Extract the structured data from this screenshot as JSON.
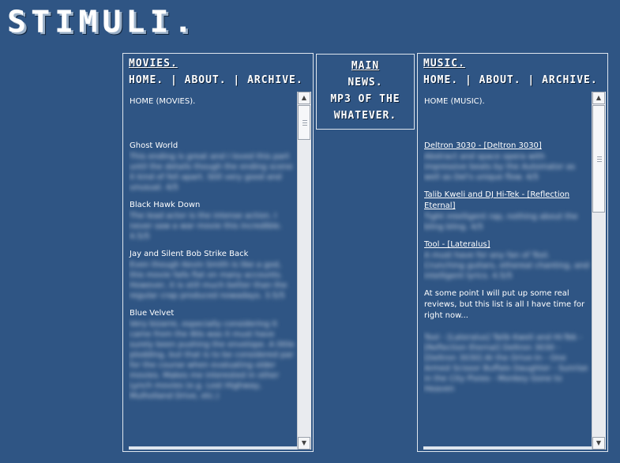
{
  "logo": "STIMULI.",
  "left_panel": {
    "title": "MOVIES.",
    "nav": [
      "HOME.",
      "|",
      "ABOUT.",
      "|",
      "ARCHIVE."
    ],
    "heading": "HOME (MOVIES).",
    "items": [
      {
        "title": "Ghost World",
        "text": "This ending is great and I loved this part until the details though the ending scene it kind of fell apart. Still very good and unusual. 4/5"
      },
      {
        "title": "Black Hawk Down",
        "text": "The lead actor is the intense action. I never saw a war movie this incredible. 4.5/5"
      },
      {
        "title": "Jay and Silent Bob Strike Back",
        "text": "Even though Kevin Smith is like a god, this movie falls flat on many accounts. However, it is still much better than the regular crap produced nowadays. 3.5/5"
      },
      {
        "title": "Blue Velvet",
        "text": "Very bizarre, especially considering it came from the 80s was it must have surely been pushing the envelope. A little plodding, but that is to be considered par for the course when evaluating older movies. Makes me interested in other Lynch movies (e.g. Lost Highway, Mulholland Drive, etc.)"
      }
    ]
  },
  "center_panel": {
    "lines": [
      "MAIN",
      "NEWS.",
      "MP3 OF THE",
      "WHATEVER."
    ]
  },
  "right_panel": {
    "title": "MUSIC.",
    "nav": [
      "HOME.",
      "|",
      "ABOUT.",
      "|",
      "ARCHIVE."
    ],
    "heading": "HOME (MUSIC).",
    "items": [
      {
        "title": "Deltron 3030 - [Deltron 3030]",
        "text": "Abstract and space opera with impressive beats by the Automator as well as Del's unique flow. 4/5"
      },
      {
        "title": "Talib Kweli and DJ Hi-Tek - [Reflection Eternal]",
        "text": "Tight intelligent rap, nothing about the bling bling. 4/5"
      },
      {
        "title": "Tool - [Lateralus]",
        "text": "A must have for any fan of Tool. Crunching guitars, ethereal chanting, and intelligent lyrics. 4.5/5"
      }
    ],
    "note": "At some point I will put up some real reviews, but this list is all I have time for right now...",
    "list_text": "Tool - [Lateralus] Talib Kweli and Hi-Tek - [Reflection Eternal] Deltron 3030 - [Deltron 3030] At the Drive-In - One Armed Scissor Buffalo Daughter - Sunrise in the City Pixies - Monkey Gone to Heaven"
  },
  "colors": {
    "background": "#2f5584",
    "border": "#dfe6ee",
    "text": "#ffffff"
  }
}
